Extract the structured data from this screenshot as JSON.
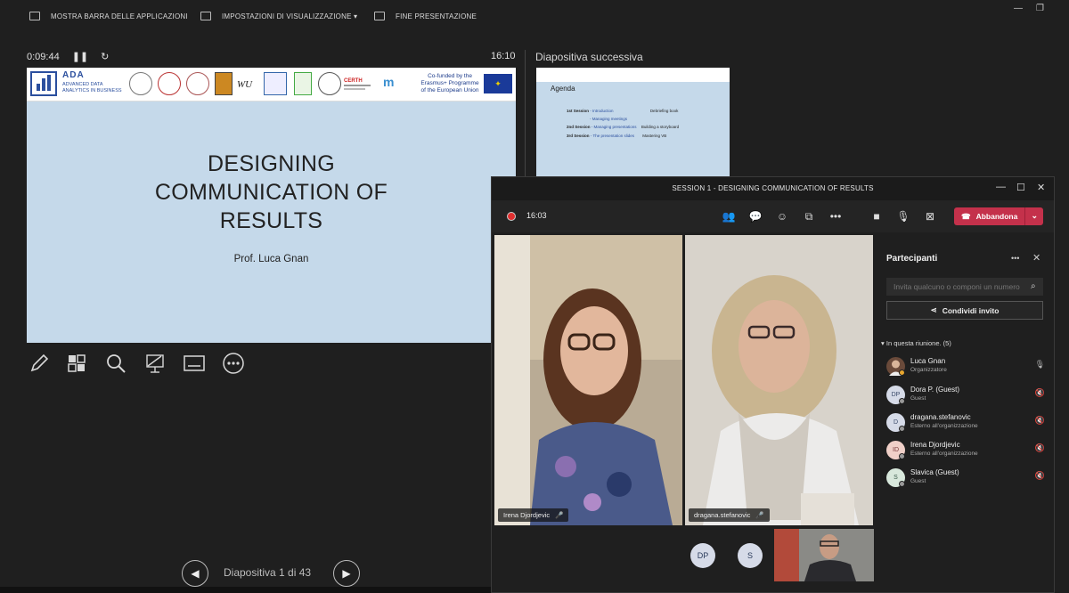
{
  "topbar": {
    "taskbar_label": "MOSTRA BARRA DELLE APPLICAZIONI",
    "display_settings_label": "IMPOSTAZIONI DI VISUALIZZAZIONE ▾",
    "end_presentation_label": "FINE PRESENTAZIONE"
  },
  "presenter": {
    "elapsed": "0:09:44",
    "clock": "16:10",
    "next_label": "Diapositiva successiva",
    "counter": "Diapositiva 1 di 43"
  },
  "slide": {
    "logo_title": "ADA",
    "logo_subtitle": "ADVANCED DATA ANALYTICS IN BUSINESS",
    "cofund": "Co-funded by the Erasmus+ Programme of the European Union",
    "title_line1": "DESIGNING",
    "title_line2": "COMMUNICATION OF",
    "title_line3": "RESULTS",
    "author": "Prof. Luca Gnan"
  },
  "next_slide": {
    "title": "Agenda",
    "lines": [
      {
        "session": "1st Session",
        "topic": "- Introduction",
        "note": "Debriefing book"
      },
      {
        "session": "",
        "topic": "- Managing meetings",
        "note": ""
      },
      {
        "session": "2nd Session",
        "topic": "- Managing presentations",
        "note": "Building a storyboard"
      },
      {
        "session": "3rd Session",
        "topic": "- The presentation slides",
        "note": "Mastering VB"
      }
    ]
  },
  "teams": {
    "window_title": "SESSION 1 - DESIGNING COMMUNICATION OF RESULTS",
    "meeting_time": "16:03",
    "leave_label": "Abbandona",
    "videos": [
      {
        "name": "Irena Djordjevic"
      },
      {
        "name": "dragana.stefanovic"
      }
    ],
    "bottom_avatars": [
      "DP",
      "S"
    ],
    "panel": {
      "title": "Partecipanti",
      "invite_placeholder": "Invita qualcuno o componi un numero",
      "share_label": "Condividi invito",
      "section_label": "In questa riunione. (5)",
      "participants": [
        {
          "initials": "",
          "name": "Luca Gnan",
          "role": "Organizzatore"
        },
        {
          "initials": "DP",
          "name": "Dora P. (Guest)",
          "role": "Guest"
        },
        {
          "initials": "D",
          "name": "dragana.stefanovic",
          "role": "Esterno all'organizzazione"
        },
        {
          "initials": "ID",
          "name": "Irena Djordjevic",
          "role": "Esterno all'organizzazione"
        },
        {
          "initials": "S",
          "name": "Slavica (Guest)",
          "role": "Guest"
        }
      ]
    }
  },
  "colors": {
    "slide_bg": "#c5d9ea",
    "leave_red": "#c4314b",
    "ada_blue": "#2b4f9e"
  }
}
